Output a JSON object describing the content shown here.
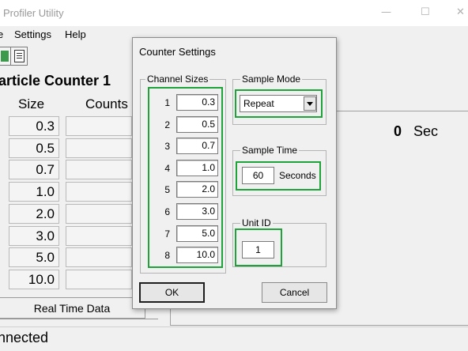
{
  "app": {
    "title": "Profiler Utility",
    "window_controls": {
      "minimize": "—",
      "maximize": "☐",
      "close": "✕"
    }
  },
  "menu": {
    "items": [
      "e",
      "Settings",
      "Help"
    ]
  },
  "toolbar": {
    "icons": [
      "green-icon",
      "document-properties-icon"
    ]
  },
  "counter": {
    "title": "article Counter 1",
    "size_header": "Size",
    "counts_header": "Counts",
    "sizes": [
      "0.3",
      "0.5",
      "0.7",
      "1.0",
      "2.0",
      "3.0",
      "5.0",
      "10.0"
    ]
  },
  "tabs": {
    "realtime": "Real Time Data"
  },
  "timer": {
    "value": "0",
    "unit": "Sec"
  },
  "status": {
    "text": "nnected"
  },
  "dialog": {
    "title": "Counter Settings",
    "channel_sizes": {
      "label": "Channel Sizes",
      "channels": [
        {
          "num": "1",
          "value": "0.3"
        },
        {
          "num": "2",
          "value": "0.5"
        },
        {
          "num": "3",
          "value": "0.7"
        },
        {
          "num": "4",
          "value": "1.0"
        },
        {
          "num": "5",
          "value": "2.0"
        },
        {
          "num": "6",
          "value": "3.0"
        },
        {
          "num": "7",
          "value": "5.0"
        },
        {
          "num": "8",
          "value": "10.0"
        }
      ]
    },
    "sample_mode": {
      "label": "Sample Mode",
      "value": "Repeat"
    },
    "sample_time": {
      "label": "Sample Time",
      "value": "60",
      "unit": "Seconds"
    },
    "unit_id": {
      "label": "Unit ID",
      "value": "1"
    },
    "ok_label": "OK",
    "cancel_label": "Cancel",
    "highlight_color": "#1fa23a"
  }
}
